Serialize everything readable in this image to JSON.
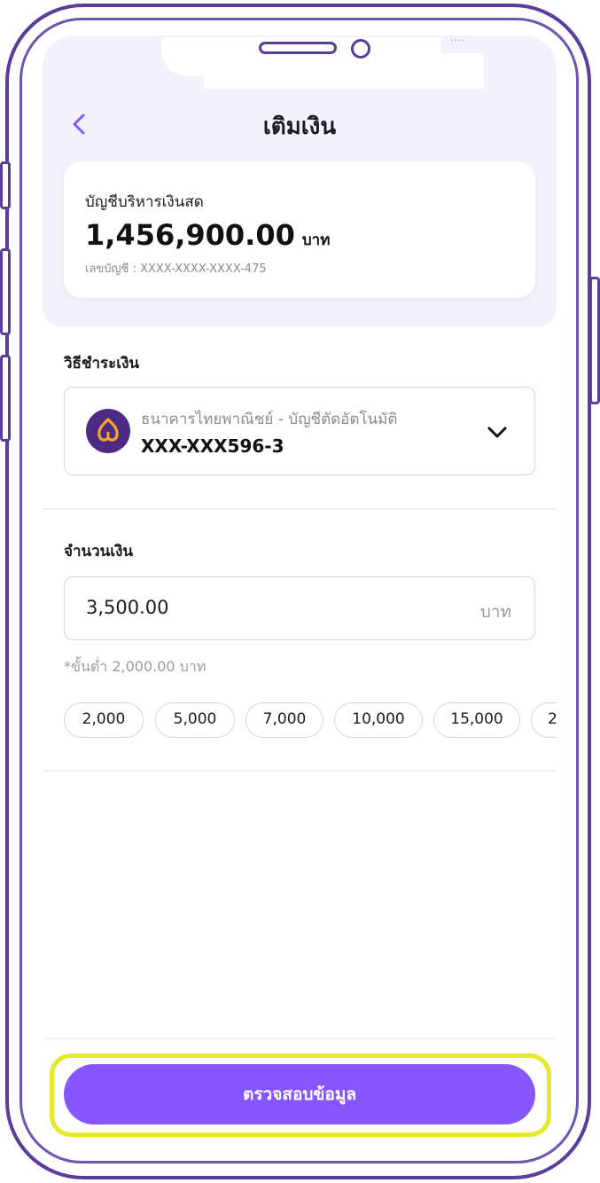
{
  "header": {
    "title": "เติมเงิน"
  },
  "account": {
    "name": "บัญชีบริหารเงินสด",
    "balance": "1,456,900.00",
    "unit": "บาท",
    "number_label": "เลขบัญชี : XXXX-XXXX-XXXX-475"
  },
  "payment": {
    "label": "วิธีชำระเงิน",
    "bank_name": "ธนาคารไทยพาณิชย์ - บัญชีตัดอัตโนมัติ",
    "account": "XXX-XXX596-3"
  },
  "amount": {
    "label": "จำนวนเงิน",
    "value": "3,500.00",
    "unit": "บาท",
    "min_note": "*ขั้นต่ำ 2,000.00 บาท"
  },
  "chips": [
    "2,000",
    "5,000",
    "7,000",
    "10,000",
    "15,000",
    "2"
  ],
  "confirm": {
    "label": "ตรวจสอบข้อมูล"
  },
  "colors": {
    "primary": "#8657ff",
    "frame": "#5a3d9a",
    "bank": "#4e2a84",
    "highlight": "#e6e82b"
  }
}
